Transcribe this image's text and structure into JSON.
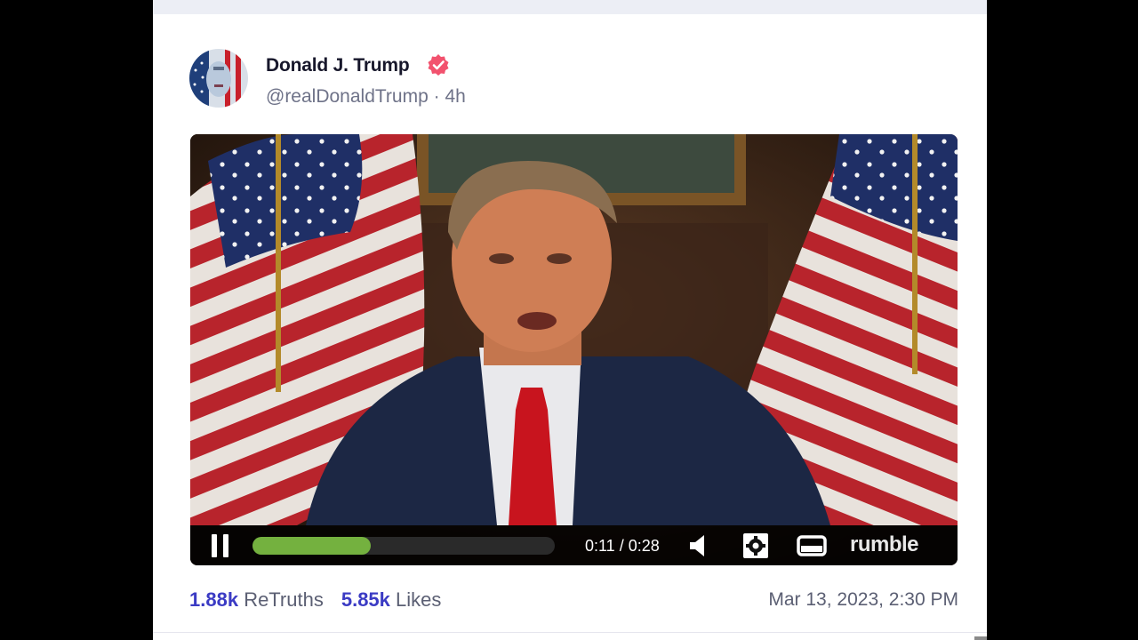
{
  "post": {
    "author_name": "Donald J. Trump",
    "handle": "@realDonaldTrump",
    "separator": "·",
    "age": "4h",
    "verified_icon": "verified-badge-icon"
  },
  "video": {
    "state": "playing",
    "current_time": "0:11",
    "duration": "0:28",
    "time_text": "0:11 / 0:28",
    "progress": 0.39,
    "provider_logo": "rumble",
    "icons": [
      "pause-icon",
      "volume-icon",
      "gear-icon",
      "screen-icon"
    ]
  },
  "stats": {
    "retruths_count": "1.88k",
    "retruths_label": "ReTruths",
    "likes_count": "5.85k",
    "likes_label": "Likes",
    "date": "Mar 13, 2023, 2:30 PM"
  },
  "colors": {
    "accent": "#3b3bc4",
    "verified": "#f2526e",
    "progress": "#74b13f"
  }
}
